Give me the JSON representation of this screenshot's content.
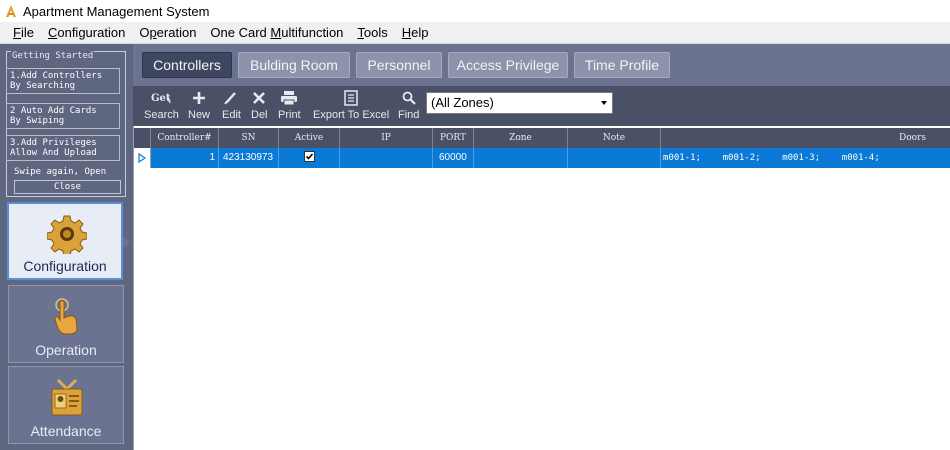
{
  "window": {
    "title": "Apartment Management System"
  },
  "menu": [
    {
      "label": "File",
      "u": "F",
      "rest": "ile"
    },
    {
      "label": "Configuration",
      "u": "C",
      "rest": "onfiguration"
    },
    {
      "label": "Operation",
      "u": "",
      "pre": "O",
      "mid": "p",
      "post": "eration"
    },
    {
      "label": "One Card Multifunction",
      "pre": "One Card ",
      "u": "M",
      "rest": "ultifunction"
    },
    {
      "label": "Tools",
      "u": "T",
      "rest": "ools"
    },
    {
      "label": "Help",
      "u": "H",
      "rest": "elp"
    }
  ],
  "getting_started": {
    "title": "Getting Started",
    "steps": [
      "1.Add Controllers\nBy Searching",
      "2 Auto Add Cards\nBy Swiping",
      "3.Add Privileges\nAllow And Upload"
    ],
    "swipe_text": "Swipe again, Open",
    "close_label": "Close"
  },
  "nav": [
    {
      "label": "Configuration",
      "icon": "gear-icon",
      "active": true
    },
    {
      "label": "Operation",
      "icon": "hand-pointer-icon",
      "active": false
    },
    {
      "label": "Attendance",
      "icon": "id-badge-icon",
      "active": false
    }
  ],
  "tabs": [
    {
      "label": "Controllers",
      "active": true
    },
    {
      "label": "Bulding Room",
      "active": false
    },
    {
      "label": "Personnel",
      "active": false
    },
    {
      "label": "Access Privilege",
      "active": false
    },
    {
      "label": "Time Profile",
      "active": false
    }
  ],
  "toolbar": {
    "search": "Search",
    "new": "New",
    "edit": "Edit",
    "del": "Del",
    "print": "Print",
    "export": "Export To Excel",
    "find": "Find",
    "zone_value": "(All Zones)"
  },
  "grid": {
    "columns": [
      "Controller#",
      "SN",
      "Active",
      "IP",
      "PORT",
      "Zone",
      "Note",
      "Doors"
    ],
    "rows": [
      {
        "controller": "1",
        "sn": "423130973",
        "active": true,
        "ip": "",
        "port": "60000",
        "zone": "",
        "note": "",
        "doors": "m001-1;    m001-2;    m001-3;    m001-4;"
      }
    ]
  },
  "colors": {
    "panel": "#5f6780",
    "toolbar": "#4a5166",
    "selection": "#0a7ad6"
  }
}
